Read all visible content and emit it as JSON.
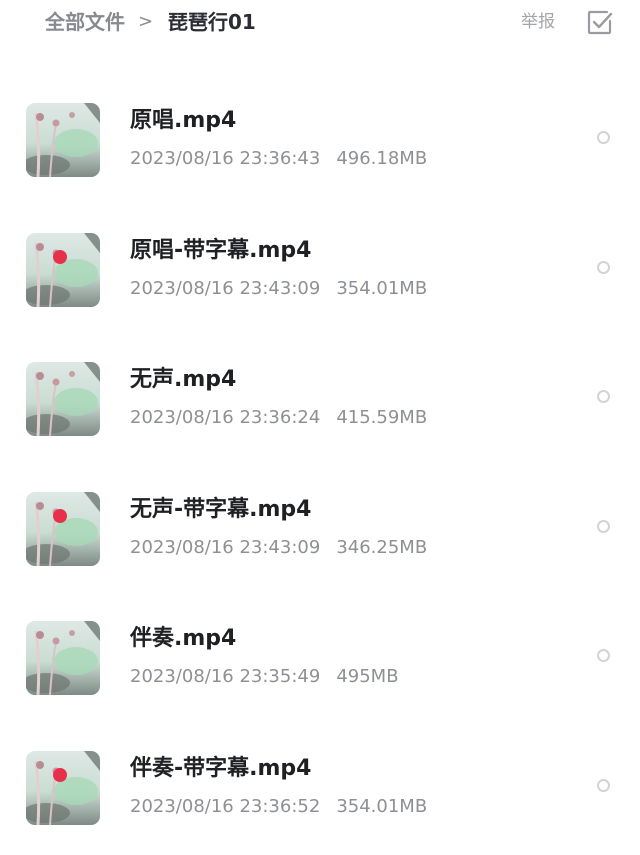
{
  "breadcrumb": {
    "root": "全部文件",
    "separator": ">",
    "current": "琵琶行01"
  },
  "toolbar": {
    "report_label": "举报",
    "select_icon": "checkbox-select-icon"
  },
  "files": [
    {
      "name": "原唱.mp4",
      "datetime": "2023/08/16 23:36:43",
      "size": "496.18MB",
      "thumb": "lotus"
    },
    {
      "name": "原唱-带字幕.mp4",
      "datetime": "2023/08/16 23:43:09",
      "size": "354.01MB",
      "thumb": "lotus-red"
    },
    {
      "name": "无声.mp4",
      "datetime": "2023/08/16 23:36:24",
      "size": "415.59MB",
      "thumb": "lotus"
    },
    {
      "name": "无声-带字幕.mp4",
      "datetime": "2023/08/16 23:43:09",
      "size": "346.25MB",
      "thumb": "lotus-red"
    },
    {
      "name": "伴奏.mp4",
      "datetime": "2023/08/16 23:35:49",
      "size": "495MB",
      "thumb": "lotus"
    },
    {
      "name": "伴奏-带字幕.mp4",
      "datetime": "2023/08/16 23:36:52",
      "size": "354.01MB",
      "thumb": "lotus-red"
    }
  ],
  "colors": {
    "title": "#1f2024",
    "meta": "#8e9095",
    "crumb": "#888a8f",
    "accent_red": "#e8304a"
  }
}
